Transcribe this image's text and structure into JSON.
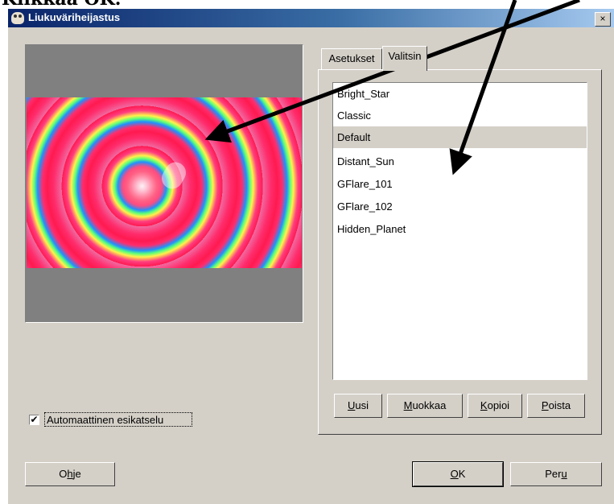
{
  "doc_heading": "Klikkaa OK.",
  "window": {
    "title": "Liukuväriheijastus",
    "close_label": "×"
  },
  "preview": {
    "auto_preview_label": "Automaattinen esikatselu",
    "auto_preview_checked": "✔"
  },
  "tabs": [
    {
      "label": "Asetukset"
    },
    {
      "label": "Valitsin"
    }
  ],
  "list": {
    "items": [
      {
        "label": "Bright_Star"
      },
      {
        "label": "Classic"
      },
      {
        "label": "Default"
      },
      {
        "label": "Distant_Sun"
      },
      {
        "label": "GFlare_101"
      },
      {
        "label": "GFlare_102"
      },
      {
        "label": "Hidden_Planet"
      }
    ],
    "selected": "Default"
  },
  "list_buttons": {
    "new": {
      "mn": "U",
      "rest": "usi"
    },
    "edit": {
      "mn": "M",
      "rest": "uokkaa"
    },
    "copy": {
      "mn": "K",
      "rest": "opioi"
    },
    "delete": {
      "mn": "P",
      "rest": "oista"
    }
  },
  "footer": {
    "help": {
      "pre": "O",
      "mn": "h",
      "post": "je"
    },
    "ok": {
      "mn": "O",
      "rest": "K"
    },
    "cancel": {
      "pre": "Per",
      "mn": "u"
    }
  },
  "colors": {
    "titlebar_start": "#0a246a",
    "titlebar_end": "#a6caf0",
    "dialog_bg": "#d4d0c8"
  }
}
